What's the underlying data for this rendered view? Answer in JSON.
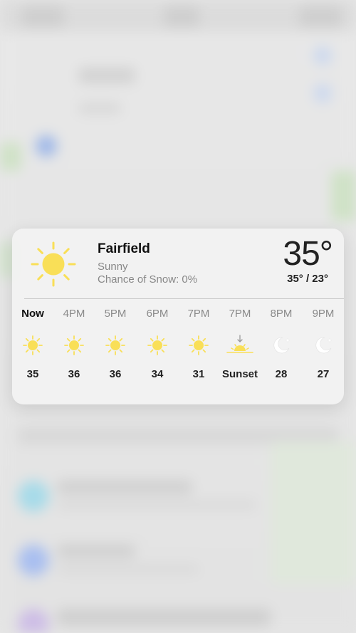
{
  "widget": {
    "city": "Fairfield",
    "condition": "Sunny",
    "chance": "Chance of Snow: 0%",
    "temperature": "35°",
    "hilo": "35° / 23°",
    "main_icon": "sun-icon"
  },
  "hourly": [
    {
      "time": "Now",
      "icon": "sun-icon",
      "value": "35"
    },
    {
      "time": "4PM",
      "icon": "sun-icon",
      "value": "36"
    },
    {
      "time": "5PM",
      "icon": "sun-icon",
      "value": "36"
    },
    {
      "time": "6PM",
      "icon": "sun-icon",
      "value": "34"
    },
    {
      "time": "7PM",
      "icon": "sun-icon",
      "value": "31"
    },
    {
      "time": "7PM",
      "icon": "sunset-icon",
      "value": "Sunset"
    },
    {
      "time": "8PM",
      "icon": "moon-icon",
      "value": "28"
    },
    {
      "time": "9PM",
      "icon": "moon-icon",
      "value": "27"
    }
  ],
  "colors": {
    "sun": "#f9df57",
    "moon": "#ffffff",
    "card": "#f2f2f2"
  }
}
